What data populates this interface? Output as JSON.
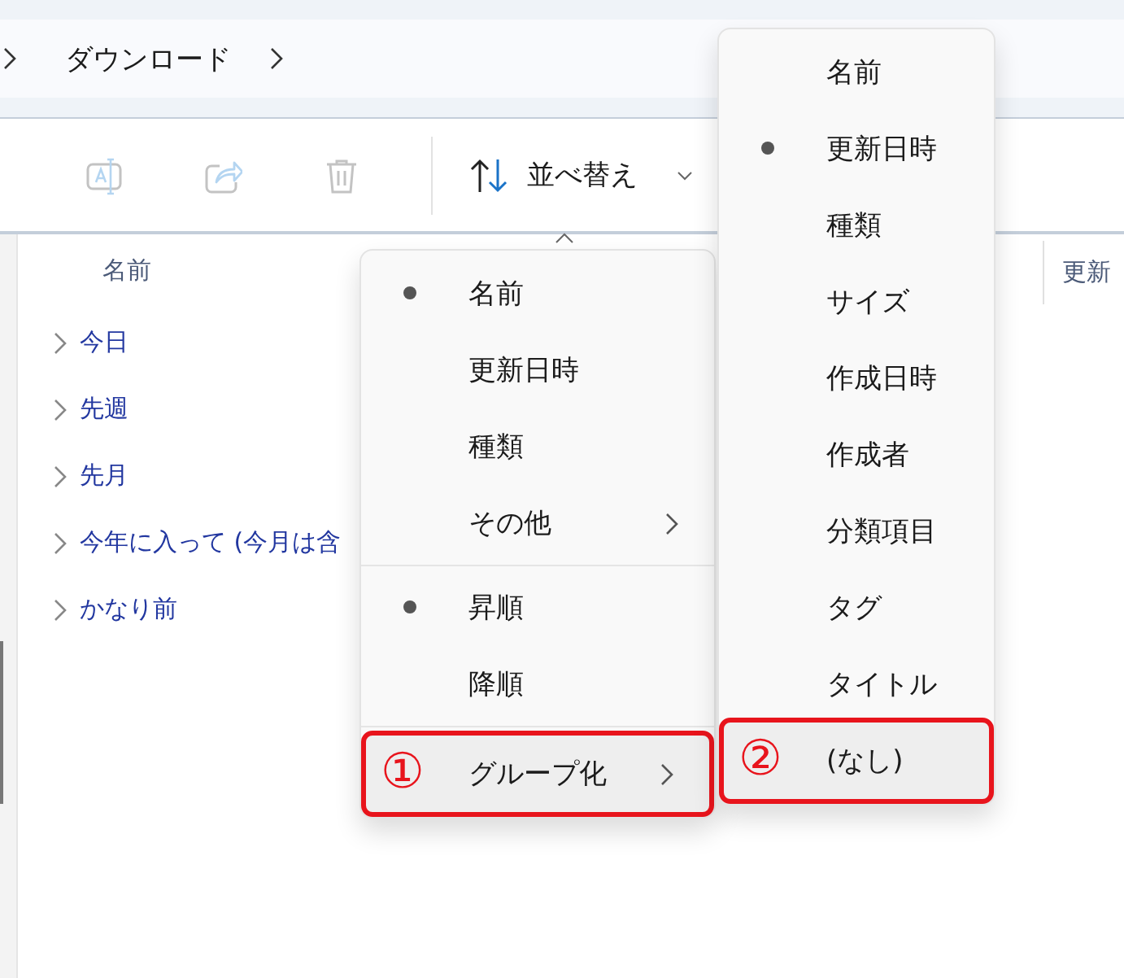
{
  "address_bar": {
    "breadcrumbs": [
      "ダウンロード"
    ]
  },
  "toolbar": {
    "buttons": [
      {
        "kind": "rename",
        "disabled": true
      },
      {
        "kind": "share",
        "disabled": true
      },
      {
        "kind": "delete",
        "disabled": true
      },
      {
        "kind": "sort",
        "label": "並べ替え"
      }
    ]
  },
  "file_list": {
    "columns": [
      "名前",
      "更新"
    ],
    "groups": [
      {
        "label": "今日",
        "expanded": false
      },
      {
        "label": "先週",
        "expanded": false
      },
      {
        "label": "先月",
        "expanded": false
      },
      {
        "label": "今年に入って (今月は含",
        "expanded": false
      },
      {
        "label": "かなり前",
        "expanded": false
      }
    ]
  },
  "sort_menu": {
    "sections": [
      [
        {
          "label": "名前",
          "selected": true,
          "submenu": false,
          "highlighted": false
        },
        {
          "label": "更新日時",
          "selected": false,
          "submenu": false,
          "highlighted": false
        },
        {
          "label": "種類",
          "selected": false,
          "submenu": false,
          "highlighted": false
        },
        {
          "label": "その他",
          "selected": false,
          "submenu": true,
          "highlighted": false
        }
      ],
      [
        {
          "label": "昇順",
          "selected": true,
          "submenu": false,
          "highlighted": false
        },
        {
          "label": "降順",
          "selected": false,
          "submenu": false,
          "highlighted": false
        }
      ],
      [
        {
          "label": "グループ化",
          "selected": false,
          "submenu": true,
          "highlighted": true,
          "badge": "①"
        }
      ]
    ]
  },
  "group_by_menu": {
    "items": [
      {
        "label": "名前",
        "selected": false,
        "highlighted": false
      },
      {
        "label": "更新日時",
        "selected": true,
        "highlighted": false
      },
      {
        "label": "種類",
        "selected": false,
        "highlighted": false
      },
      {
        "label": "サイズ",
        "selected": false,
        "highlighted": false
      },
      {
        "label": "作成日時",
        "selected": false,
        "highlighted": false
      },
      {
        "label": "作成者",
        "selected": false,
        "highlighted": false
      },
      {
        "label": "分類項目",
        "selected": false,
        "highlighted": false
      },
      {
        "label": "タグ",
        "selected": false,
        "highlighted": false
      },
      {
        "label": "タイトル",
        "selected": false,
        "highlighted": false
      },
      {
        "label": "(なし)",
        "selected": false,
        "highlighted": true,
        "badge": "②"
      }
    ]
  }
}
